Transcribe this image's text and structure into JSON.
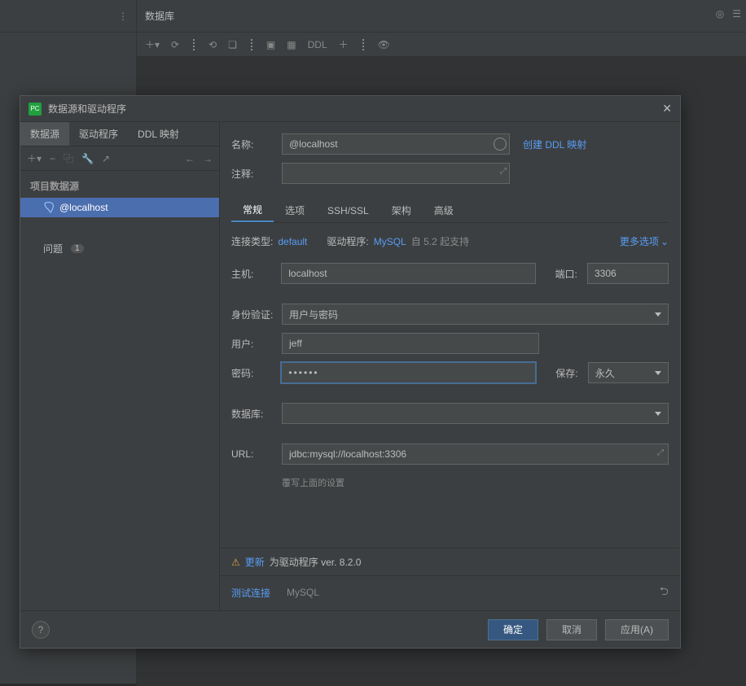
{
  "bg": {
    "title": "数据库",
    "ddl": "DDL"
  },
  "dialog": {
    "title": "数据源和驱动程序",
    "leftTabs": {
      "dataSources": "数据源",
      "drivers": "驱动程序",
      "ddl": "DDL 映射"
    },
    "leftSection": "项目数据源",
    "treeItem": "@localhost",
    "problems": "问题",
    "problemsCount": "1",
    "form": {
      "nameLabel": "名称:",
      "name": "@localhost",
      "createDdl": "创建 DDL 映射",
      "commentLabel": "注释:",
      "comment": ""
    },
    "subTabs": {
      "general": "常规",
      "options": "选项",
      "ssh": "SSH/SSL",
      "schema": "架构",
      "advanced": "高级"
    },
    "conn": {
      "typeLabel": "连接类型:",
      "type": "default",
      "driverLabel": "驱动程序:",
      "driver": "MySQL",
      "since": "自 5.2 起支持",
      "more": "更多选项"
    },
    "fields": {
      "hostLabel": "主机:",
      "host": "localhost",
      "portLabel": "端口:",
      "port": "3306",
      "authLabel": "身份验证:",
      "auth": "用户与密码",
      "userLabel": "用户:",
      "user": "jeff",
      "passLabel": "密码:",
      "pass": "••••••",
      "saveLabel": "保存:",
      "save": "永久",
      "dbLabel": "数据库:",
      "db": "",
      "urlLabel": "URL:",
      "url": "jdbc:mysql://localhost:3306",
      "urlHint": "覆写上面的设置"
    },
    "driverWarn": {
      "update": "更新",
      "rest": "为驱动程序 ver. 8.2.0"
    },
    "test": {
      "test": "测试连接",
      "driver": "MySQL"
    },
    "footer": {
      "ok": "确定",
      "cancel": "取消",
      "apply": "应用(A)"
    }
  }
}
